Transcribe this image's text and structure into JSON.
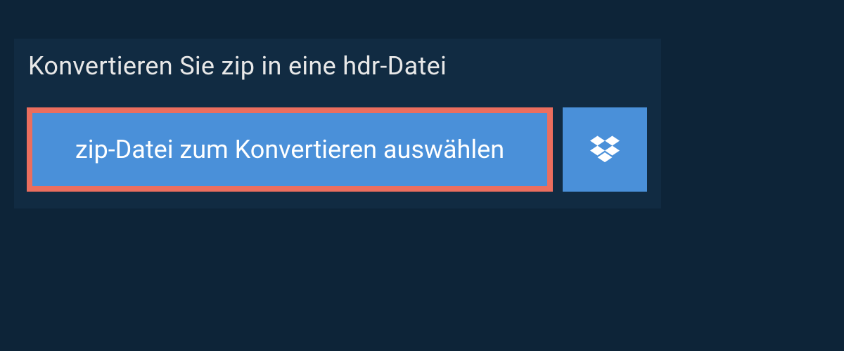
{
  "header": {
    "title": "Konvertieren Sie zip in eine hdr-Datei"
  },
  "upload": {
    "select_file_label": "zip-Datei zum Konvertieren auswählen"
  },
  "colors": {
    "page_bg": "#0d2438",
    "panel_bg": "#112b42",
    "button_bg": "#4a90d9",
    "highlight_border": "#eb6e5e",
    "text_light": "#e8e8e8",
    "text_white": "#ffffff"
  }
}
